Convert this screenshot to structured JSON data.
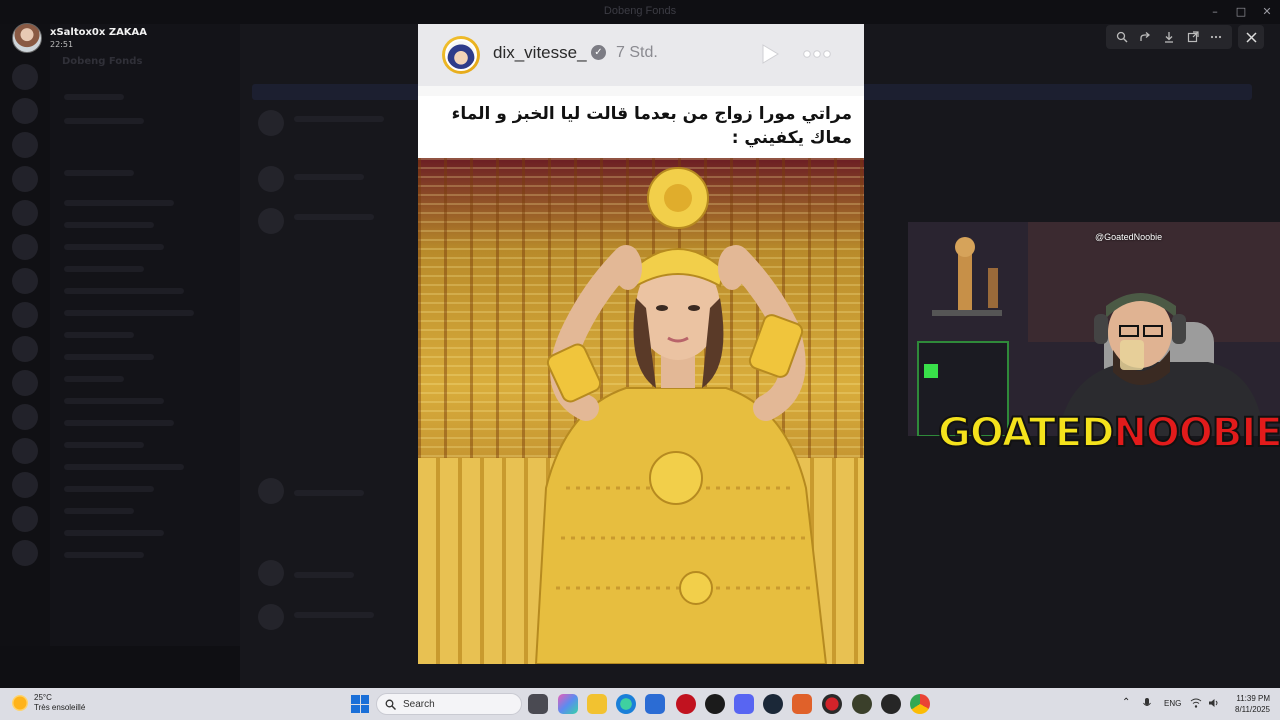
{
  "viewer": {
    "window_title": "Dobeng Fonds",
    "server_name": "Dobeng Fonds",
    "uploader_name": "xSaltox0x ZAKAA",
    "uploader_time": "22:51"
  },
  "story": {
    "username": "dix_vitesse_",
    "age": "7 Std.",
    "caption": "مراتي مورا زواج من بعدما قالت ليا الخبز و الماء معاك يكفيني :"
  },
  "webcam": {
    "tag": "@GoatedNoobie",
    "logo_part1": "GOATED",
    "logo_part2": "NOOBIE"
  },
  "taskbar": {
    "temperature": "25°C",
    "condition": "Très ensoleillé",
    "search_label": "Search",
    "lang": "ENG",
    "time": "11:39 PM",
    "date": "8/11/2025"
  },
  "colors": {
    "accent_blue": "#1a6fd8",
    "logo_yellow": "#f4e21c",
    "logo_red": "#e21b1b"
  }
}
